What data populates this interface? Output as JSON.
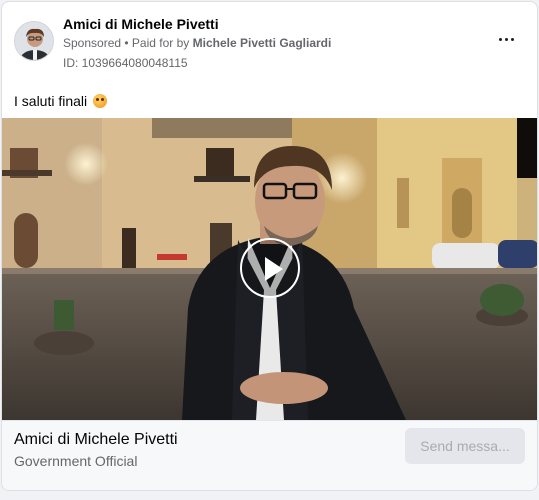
{
  "post": {
    "page_name": "Amici di Michele Pivetti",
    "sponsored_label": "Sponsored",
    "paid_for_prefix": " • Paid for by ",
    "payer": "Michele Pivetti Gagliardi",
    "ad_id": "ID: 1039664080048115",
    "more_icon": "more-horizontal-icon",
    "caption": "I saluti finali",
    "caption_emoji": "smiling-face-emoji"
  },
  "video": {
    "play_icon": "play-icon"
  },
  "footer": {
    "page_name": "Amici di Michele Pivetti",
    "category": "Government Official",
    "button_label": "Send messa..."
  },
  "colors": {
    "card_bg": "#ffffff",
    "secondary_text": "#65676b",
    "button_bg": "#e4e6eb",
    "button_text": "#a8abaf"
  }
}
